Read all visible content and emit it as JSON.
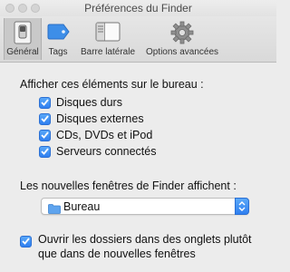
{
  "window": {
    "title": "Préférences du Finder"
  },
  "toolbar": {
    "tabs": [
      {
        "label": "Général",
        "icon": "general-switch-icon",
        "selected": true
      },
      {
        "label": "Tags",
        "icon": "tag-icon",
        "selected": false
      },
      {
        "label": "Barre latérale",
        "icon": "sidebar-icon",
        "selected": false
      },
      {
        "label": "Options avancées",
        "icon": "gear-icon",
        "selected": false
      }
    ]
  },
  "desktop_section": {
    "heading": "Afficher ces éléments sur le bureau :",
    "items": [
      {
        "label": "Disques durs",
        "checked": true
      },
      {
        "label": "Disques externes",
        "checked": true
      },
      {
        "label": "CDs, DVDs et iPod",
        "checked": true
      },
      {
        "label": "Serveurs connectés",
        "checked": true
      }
    ]
  },
  "new_windows": {
    "heading": "Les nouvelles fenêtres de Finder affichent :",
    "selected": "Bureau",
    "icon": "folder-icon"
  },
  "tabs_option": {
    "line1": "Ouvrir les dossiers dans des onglets plutôt",
    "line2": "que dans de nouvelles fenêtres",
    "checked": true
  },
  "colors": {
    "accent": "#2f7ff0",
    "tag_blue": "#3d8ee8"
  }
}
